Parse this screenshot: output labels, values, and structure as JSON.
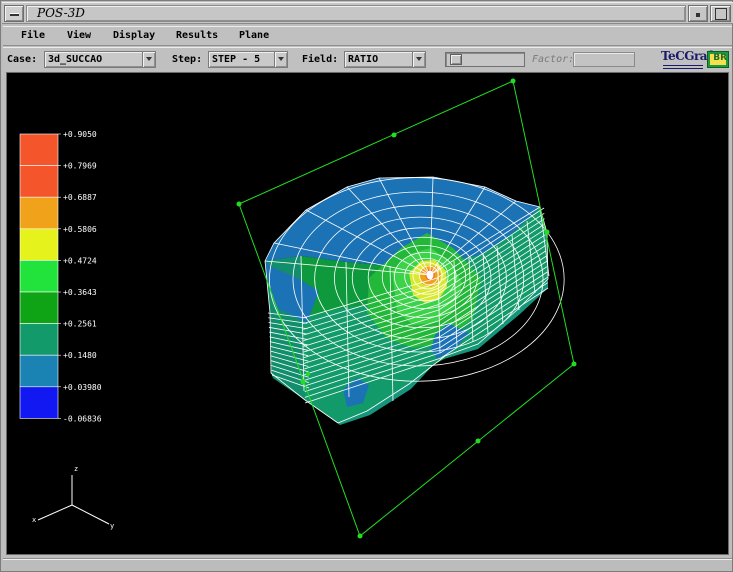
{
  "window": {
    "title": "POS-3D"
  },
  "menu": {
    "items": [
      "File",
      "View",
      "Display",
      "Results",
      "Plane"
    ]
  },
  "toolbar": {
    "case_label": "Case:",
    "case_value": "3d_SUCCAO",
    "step_label": "Step:",
    "step_value": "STEP - 5",
    "field_label": "Field:",
    "field_value": "RATIO",
    "factor_label": "Factor:",
    "factor_value": ""
  },
  "logo": {
    "text": "TeCGraf",
    "badge": "BR"
  },
  "legend": {
    "values": [
      "+0.9050",
      "+0.7969",
      "+0.6887",
      "+0.5806",
      "+0.4724",
      "+0.3643",
      "+0.2561",
      "+0.1480",
      "+0.03980",
      "-0.06836"
    ],
    "colors": [
      "#f4552b",
      "#f4552b",
      "#f0a21a",
      "#e6f21c",
      "#22e33b",
      "#0fa416",
      "#139a6b",
      "#1a83b4",
      "#1218f2"
    ]
  },
  "axes": {
    "labels": [
      "z",
      "x",
      "y"
    ]
  },
  "model": {
    "wire_color": "#ffffff",
    "plane_color": "#22dd22"
  }
}
